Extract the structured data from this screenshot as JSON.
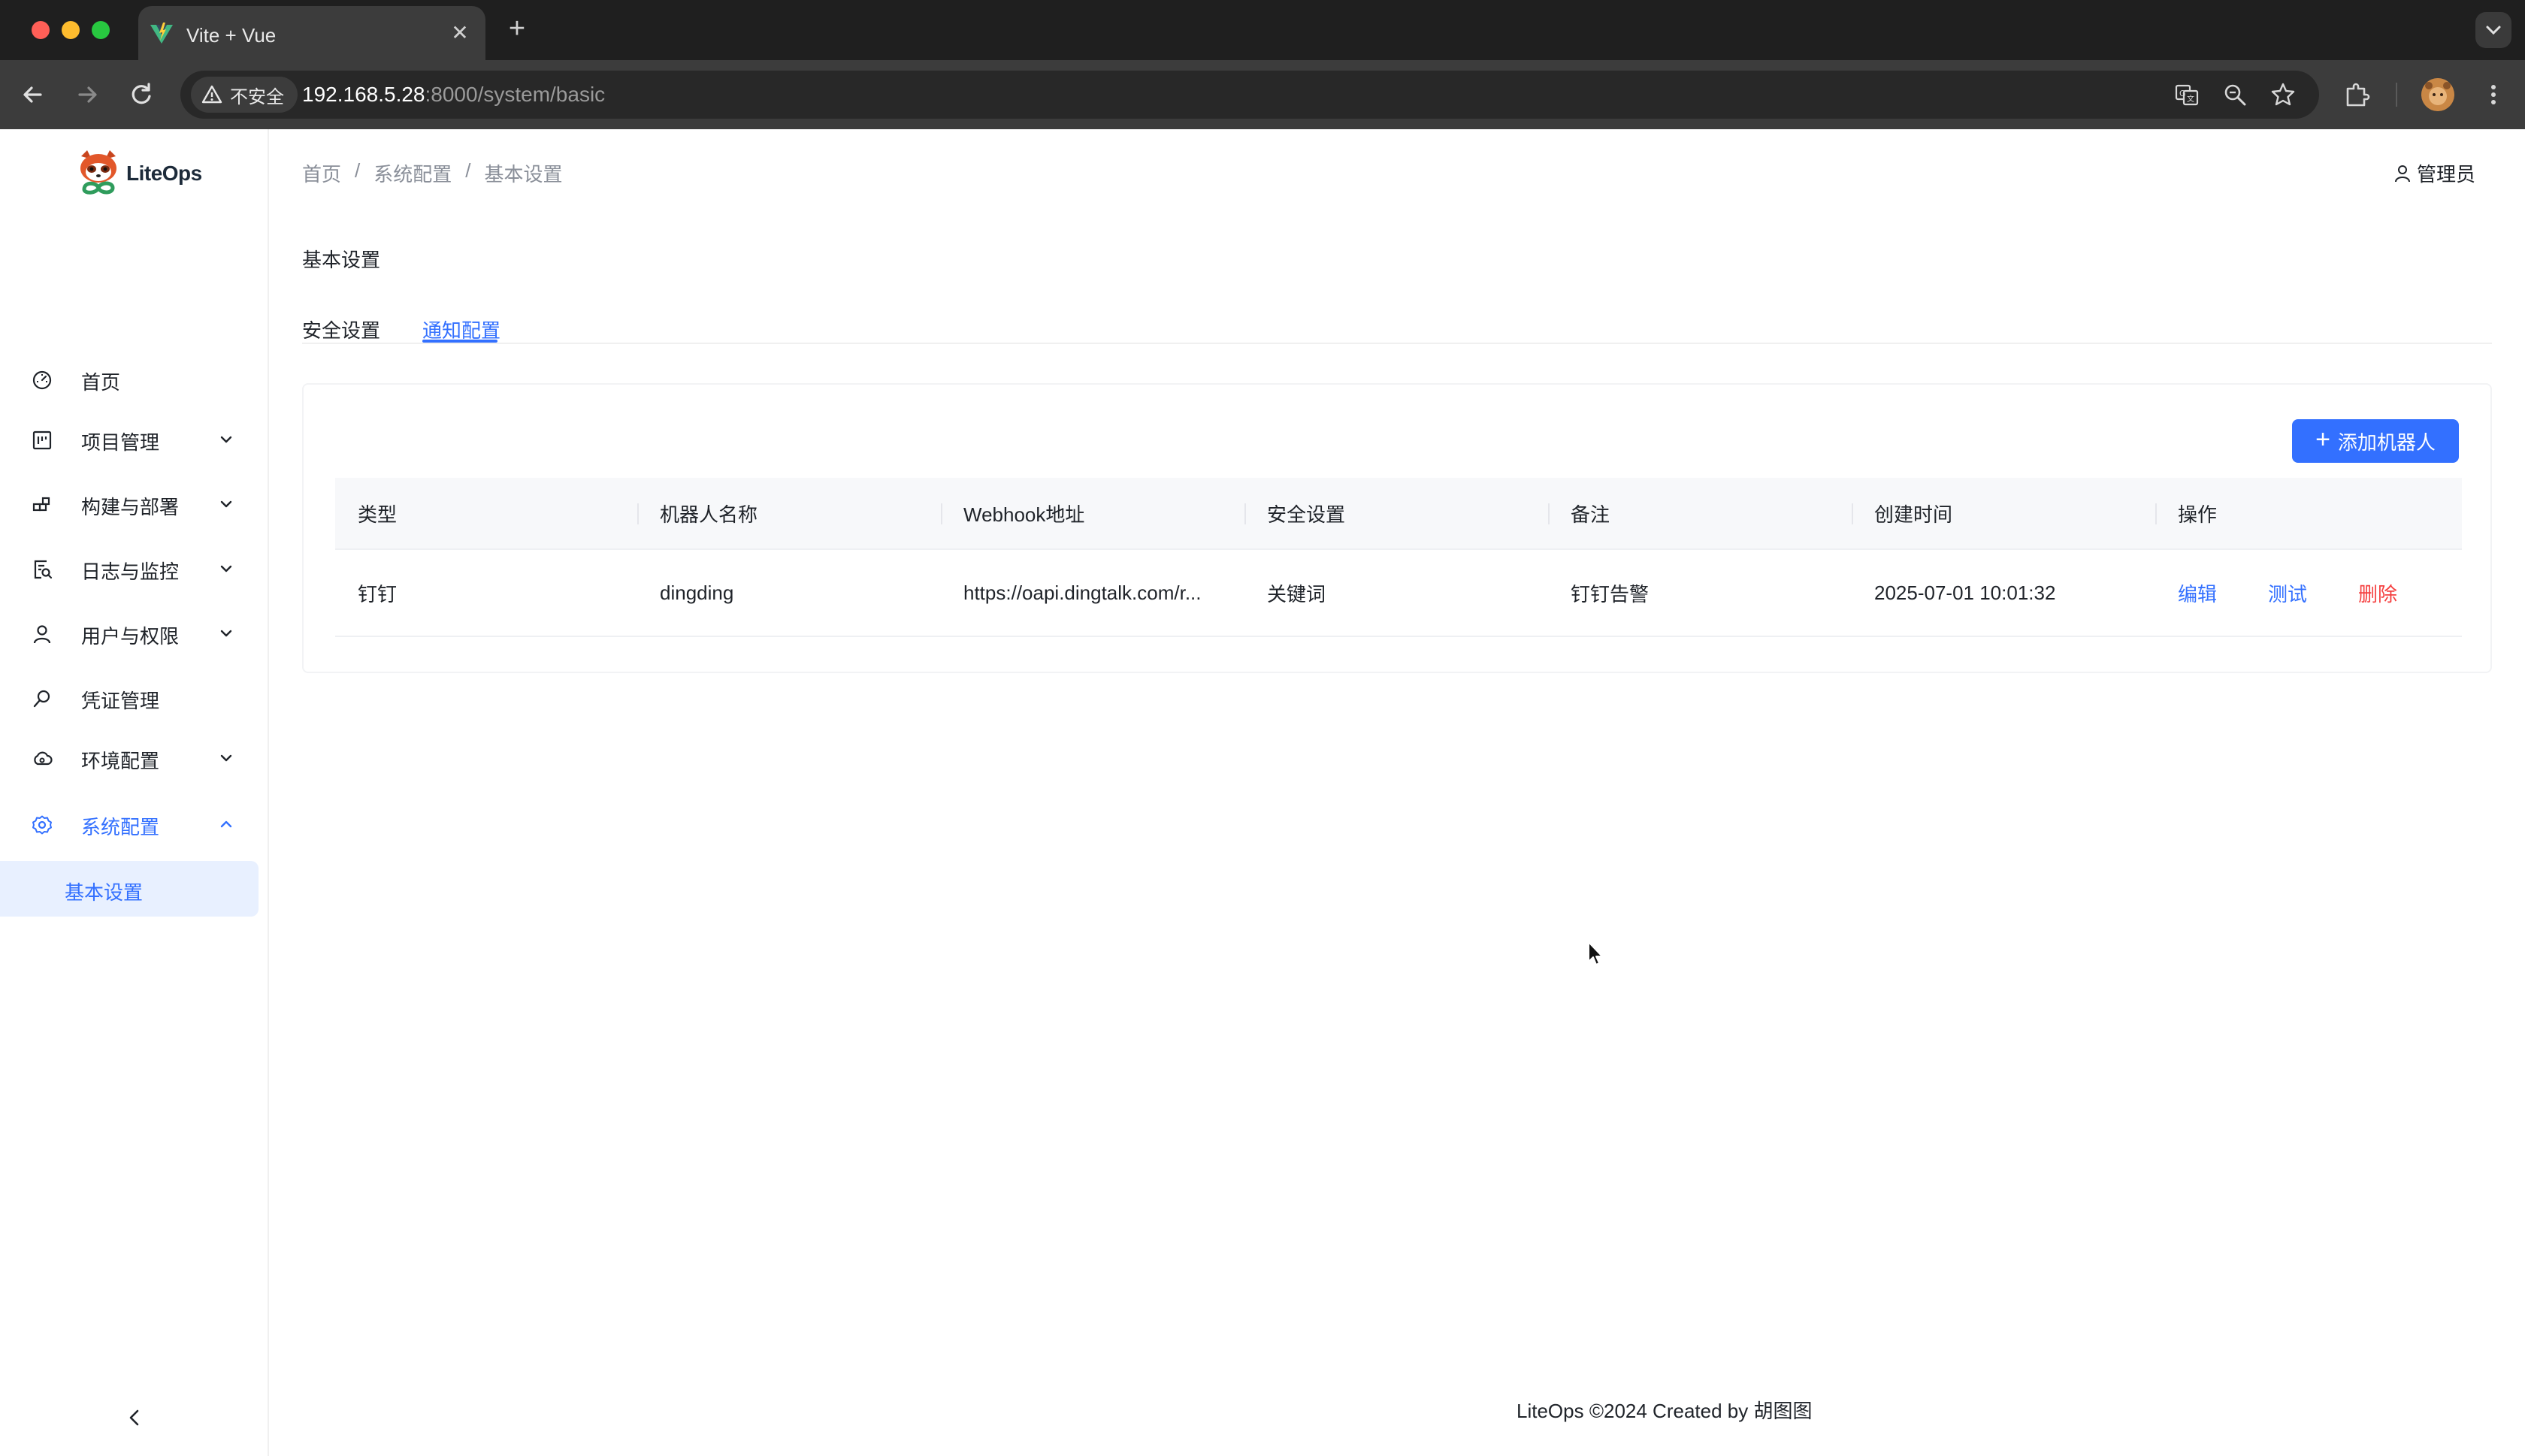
{
  "browser": {
    "tab_title": "Vite + Vue",
    "security_label": "不安全",
    "url_host": "192.168.5.28",
    "url_rest": ":8000/system/basic"
  },
  "app": {
    "logo_text": "LiteOps"
  },
  "sidebar": {
    "items": [
      {
        "label": "首页",
        "icon": "dashboard-icon"
      },
      {
        "label": "项目管理",
        "icon": "project-icon"
      },
      {
        "label": "构建与部署",
        "icon": "deploy-icon"
      },
      {
        "label": "日志与监控",
        "icon": "log-monitor-icon"
      },
      {
        "label": "用户与权限",
        "icon": "user-icon"
      },
      {
        "label": "凭证管理",
        "icon": "key-icon"
      },
      {
        "label": "环境配置",
        "icon": "cloud-icon"
      },
      {
        "label": "系统配置",
        "icon": "gear-icon"
      }
    ],
    "subitem": "基本设置"
  },
  "header": {
    "breadcrumb": [
      "首页",
      "系统配置",
      "基本设置"
    ],
    "separator": "/",
    "user": "管理员"
  },
  "main": {
    "title": "基本设置",
    "tabs": [
      "安全设置",
      "通知配置"
    ],
    "active_tab": "通知配置",
    "add_button": "添加机器人",
    "table": {
      "columns": [
        "类型",
        "机器人名称",
        "Webhook地址",
        "安全设置",
        "备注",
        "创建时间",
        "操作"
      ],
      "rows": [
        {
          "type": "钉钉",
          "name": "dingding",
          "webhook": "https://oapi.dingtalk.com/r...",
          "security": "关键词",
          "remark": "钉钉告警",
          "created": "2025-07-01 10:01:32"
        }
      ],
      "actions": [
        "编辑",
        "测试",
        "删除"
      ]
    }
  },
  "footer": {
    "text": "LiteOps ©2024 Created by 胡图图"
  },
  "colors": {
    "accent": "#3370ff",
    "danger": "#f53f3f",
    "chrome_dark": "#1f1f1f"
  }
}
